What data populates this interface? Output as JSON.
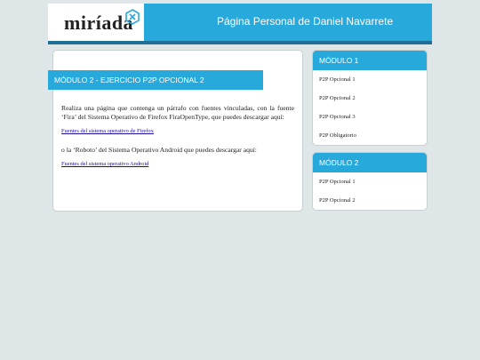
{
  "header": {
    "logo_text": "miríada",
    "logo_badge": "x",
    "title": "Página Personal de Daniel Navarrete",
    "accent": "#28a9dc",
    "accent_dark": "#1f6f96"
  },
  "main": {
    "section_title": "MÓDULO 2 - EJERCICIO P2P OPCIONAL 2",
    "paragraph1": "Realiza una página que contenga un párrafo con fuentes vinculadas, con la fuente ‘Fira’ del Sistema Operativo de Firefox FiraOpenType, que puedes descargar aquí:",
    "link1": "Fuentes del sistema operativo de Firefox",
    "paragraph2": "o la ‘Roboto’ del Sistema Operativo Android que puedes descargar aquí:",
    "link2": "Fuentes del sistema operativo Android"
  },
  "sidebar": {
    "modules": [
      {
        "title": "MÓDULO 1",
        "items": [
          "P2P Opcional 1",
          "P2P Opcional 2",
          "P2P Opcional 3",
          "P2P Obligatorio"
        ]
      },
      {
        "title": "MÓDULO 2",
        "items": [
          "P2P Opcional 1",
          "P2P Opcional 2"
        ]
      }
    ]
  }
}
